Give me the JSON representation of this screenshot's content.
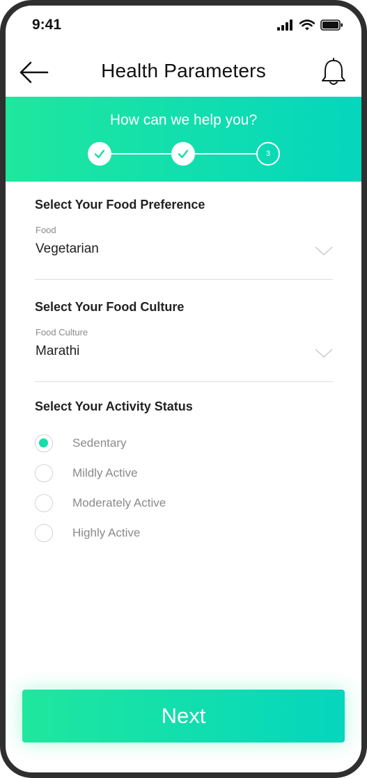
{
  "status_bar": {
    "time": "9:41"
  },
  "header": {
    "title": "Health Parameters",
    "back_icon": "arrow-left-icon",
    "bell_icon": "bell-icon"
  },
  "banner": {
    "title": "How can we help you?",
    "steps": [
      {
        "state": "done"
      },
      {
        "state": "done"
      },
      {
        "state": "pending",
        "label": "3"
      }
    ]
  },
  "food_preference": {
    "section_title": "Select Your Food Preference",
    "field_label": "Food",
    "value": "Vegetarian"
  },
  "food_culture": {
    "section_title": "Select Your Food Culture",
    "field_label": "Food Culture",
    "value": "Marathi"
  },
  "activity": {
    "section_title": "Select Your Activity Status",
    "options": [
      {
        "label": "Sedentary",
        "selected": true
      },
      {
        "label": "Mildly Active",
        "selected": false
      },
      {
        "label": "Moderately Active",
        "selected": false
      },
      {
        "label": "Highly Active",
        "selected": false
      }
    ]
  },
  "actions": {
    "next_label": "Next"
  },
  "colors": {
    "accent_start": "#1fe79e",
    "accent_end": "#05d6bd",
    "radio_selected": "#12dfa8"
  }
}
